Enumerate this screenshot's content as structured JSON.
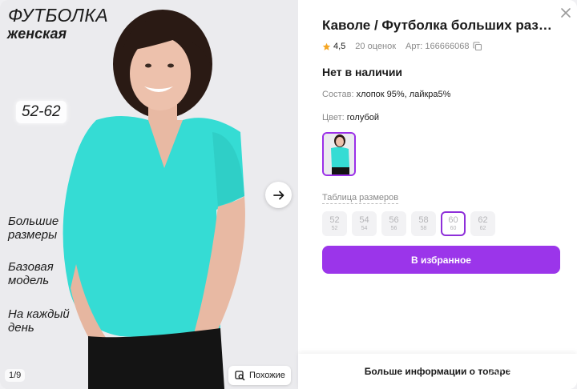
{
  "gallery": {
    "promo": {
      "title": "ФУТБОЛКА",
      "subtitle": "женская",
      "sizes": "52-62",
      "features": [
        "Большие\nразмеры",
        "Базовая\nмодель",
        "На каждый\nдень"
      ]
    },
    "counter": "1/9",
    "similar_label": "Похожие",
    "shirt_color": "#35dcd4"
  },
  "product": {
    "title": "Каволе / Футболка больших раз…",
    "rating": "4,5",
    "reviews": "20 оценок",
    "article": "Арт: 166666068",
    "stock": "Нет в наличии",
    "composition_label": "Состав:",
    "composition_value": "хлопок 95%, лайкра5%",
    "color_label": "Цвет:",
    "color_value": "голубой",
    "size_table_link": "Таблица размеров",
    "sizes": [
      {
        "n": "52",
        "s": "52",
        "selected": false
      },
      {
        "n": "54",
        "s": "54",
        "selected": false
      },
      {
        "n": "56",
        "s": "56",
        "selected": false
      },
      {
        "n": "58",
        "s": "58",
        "selected": false
      },
      {
        "n": "60",
        "s": "60",
        "selected": true
      },
      {
        "n": "62",
        "s": "62",
        "selected": false
      }
    ],
    "favorite_button": "В избранное",
    "more_info": "Больше информации о товаре"
  },
  "watermark": "Avito",
  "colors": {
    "accent": "#9b35ea",
    "star": "#f5a623"
  }
}
